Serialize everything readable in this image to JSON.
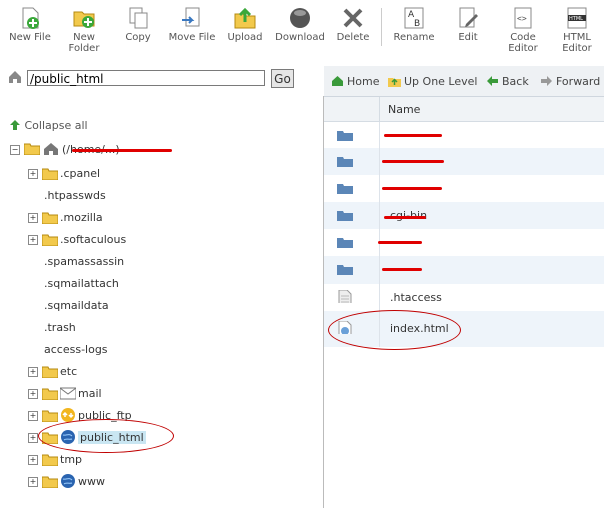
{
  "toolbar": {
    "new_file": "New File",
    "new_folder": "New\nFolder",
    "copy": "Copy",
    "move_file": "Move File",
    "upload": "Upload",
    "download": "Download",
    "delete": "Delete",
    "rename": "Rename",
    "edit": "Edit",
    "code_editor": "Code\nEditor",
    "html_editor": "HTML\nEditor"
  },
  "path": {
    "value": "/public_html",
    "go": "Go"
  },
  "nav": {
    "home": "Home",
    "up": "Up One Level",
    "back": "Back",
    "forward": "Forward"
  },
  "tree": {
    "collapse": "Collapse all",
    "root_label": "(/home/...)",
    "items": [
      {
        "label": ".cpanel"
      },
      {
        "label": ".htpasswds"
      },
      {
        "label": ".mozilla"
      },
      {
        "label": ".softaculous"
      },
      {
        "label": ".spamassassin"
      },
      {
        "label": ".sqmailattach"
      },
      {
        "label": ".sqmaildata"
      },
      {
        "label": ".trash"
      },
      {
        "label": "access-logs"
      },
      {
        "label": "etc"
      },
      {
        "label": "mail"
      },
      {
        "label": "public_ftp"
      },
      {
        "label": "public_html"
      },
      {
        "label": "tmp"
      },
      {
        "label": "www"
      }
    ]
  },
  "table": {
    "header_name": "Name",
    "rows": [
      {
        "name": "",
        "type": "folder"
      },
      {
        "name": "",
        "type": "folder"
      },
      {
        "name": "",
        "type": "folder"
      },
      {
        "name": "cgi-bin",
        "type": "folder"
      },
      {
        "name": "",
        "type": "folder"
      },
      {
        "name": "",
        "type": "folder"
      },
      {
        "name": ".htaccess",
        "type": "file"
      },
      {
        "name": "index.html",
        "type": "html"
      }
    ]
  },
  "colors": {
    "annotation_red": "#e00000",
    "selected_bg": "#c9e6f2",
    "folder_blue": "#5b86b7"
  }
}
